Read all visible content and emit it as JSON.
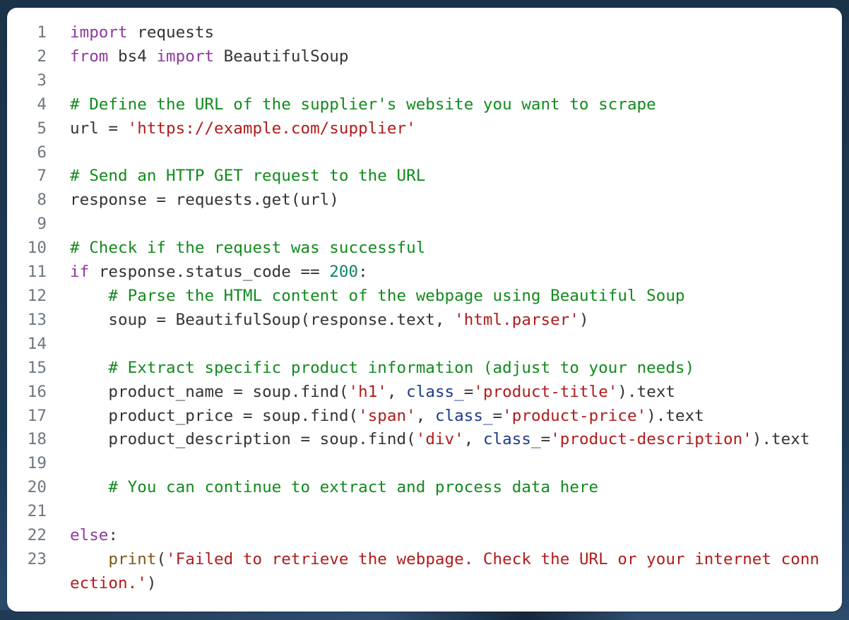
{
  "colors": {
    "background": "#1b3349",
    "card": "#ffffff",
    "line_number": "#6e7781",
    "default_text": "#333333",
    "keyword": "#8d3a9e",
    "comment": "#128a1d",
    "string": "#b01c1c",
    "number": "#0f8468",
    "builtin": "#7a5a14",
    "param": "#1e3a8a"
  },
  "code": {
    "language": "python",
    "lines": [
      {
        "n": "1",
        "tokens": [
          {
            "t": "kw",
            "v": "import"
          },
          {
            "t": "tx",
            "v": " requests"
          }
        ]
      },
      {
        "n": "2",
        "tokens": [
          {
            "t": "kw",
            "v": "from"
          },
          {
            "t": "tx",
            "v": " bs4 "
          },
          {
            "t": "kw",
            "v": "import"
          },
          {
            "t": "tx",
            "v": " BeautifulSoup"
          }
        ]
      },
      {
        "n": "3",
        "tokens": []
      },
      {
        "n": "4",
        "tokens": [
          {
            "t": "cm",
            "v": "# Define the URL of the supplier's website you want to scrape"
          }
        ]
      },
      {
        "n": "5",
        "tokens": [
          {
            "t": "tx",
            "v": "url = "
          },
          {
            "t": "st",
            "v": "'https://example.com/supplier'"
          }
        ]
      },
      {
        "n": "6",
        "tokens": []
      },
      {
        "n": "7",
        "tokens": [
          {
            "t": "cm",
            "v": "# Send an HTTP GET request to the URL"
          }
        ]
      },
      {
        "n": "8",
        "tokens": [
          {
            "t": "tx",
            "v": "response = requests.get(url)"
          }
        ]
      },
      {
        "n": "9",
        "tokens": []
      },
      {
        "n": "10",
        "tokens": [
          {
            "t": "cm",
            "v": "# Check if the request was successful"
          }
        ]
      },
      {
        "n": "11",
        "tokens": [
          {
            "t": "kw",
            "v": "if"
          },
          {
            "t": "tx",
            "v": " response.status_code == "
          },
          {
            "t": "nm",
            "v": "200"
          },
          {
            "t": "tx",
            "v": ":"
          }
        ]
      },
      {
        "n": "12",
        "tokens": [
          {
            "t": "tx",
            "v": "    "
          },
          {
            "t": "cm",
            "v": "# Parse the HTML content of the webpage using Beautiful Soup"
          }
        ]
      },
      {
        "n": "13",
        "tokens": [
          {
            "t": "tx",
            "v": "    soup = BeautifulSoup(response.text, "
          },
          {
            "t": "st",
            "v": "'html.parser'"
          },
          {
            "t": "tx",
            "v": ")"
          }
        ]
      },
      {
        "n": "14",
        "tokens": []
      },
      {
        "n": "15",
        "tokens": [
          {
            "t": "tx",
            "v": "    "
          },
          {
            "t": "cm",
            "v": "# Extract specific product information (adjust to your needs)"
          }
        ]
      },
      {
        "n": "16",
        "tokens": [
          {
            "t": "tx",
            "v": "    product_name = soup.find("
          },
          {
            "t": "st",
            "v": "'h1'"
          },
          {
            "t": "tx",
            "v": ", "
          },
          {
            "t": "pm",
            "v": "class_"
          },
          {
            "t": "tx",
            "v": "="
          },
          {
            "t": "st",
            "v": "'product-title'"
          },
          {
            "t": "tx",
            "v": ").text"
          }
        ]
      },
      {
        "n": "17",
        "tokens": [
          {
            "t": "tx",
            "v": "    product_price = soup.find("
          },
          {
            "t": "st",
            "v": "'span'"
          },
          {
            "t": "tx",
            "v": ", "
          },
          {
            "t": "pm",
            "v": "class_"
          },
          {
            "t": "tx",
            "v": "="
          },
          {
            "t": "st",
            "v": "'product-price'"
          },
          {
            "t": "tx",
            "v": ").text"
          }
        ]
      },
      {
        "n": "18",
        "tokens": [
          {
            "t": "tx",
            "v": "    product_description = soup.find("
          },
          {
            "t": "st",
            "v": "'div'"
          },
          {
            "t": "tx",
            "v": ", "
          },
          {
            "t": "pm",
            "v": "class_"
          },
          {
            "t": "tx",
            "v": "="
          },
          {
            "t": "st",
            "v": "'product-description'"
          },
          {
            "t": "tx",
            "v": ").text"
          }
        ]
      },
      {
        "n": "19",
        "tokens": []
      },
      {
        "n": "20",
        "tokens": [
          {
            "t": "tx",
            "v": "    "
          },
          {
            "t": "cm",
            "v": "# You can continue to extract and process data here"
          }
        ]
      },
      {
        "n": "21",
        "tokens": []
      },
      {
        "n": "22",
        "tokens": [
          {
            "t": "kw",
            "v": "else"
          },
          {
            "t": "tx",
            "v": ":"
          }
        ]
      },
      {
        "n": "23",
        "tokens": [
          {
            "t": "tx",
            "v": "    "
          },
          {
            "t": "bi",
            "v": "print"
          },
          {
            "t": "tx",
            "v": "("
          },
          {
            "t": "st",
            "v": "'Failed to retrieve the webpage. Check the URL or your internet connection.'"
          },
          {
            "t": "tx",
            "v": ")"
          }
        ]
      }
    ]
  }
}
